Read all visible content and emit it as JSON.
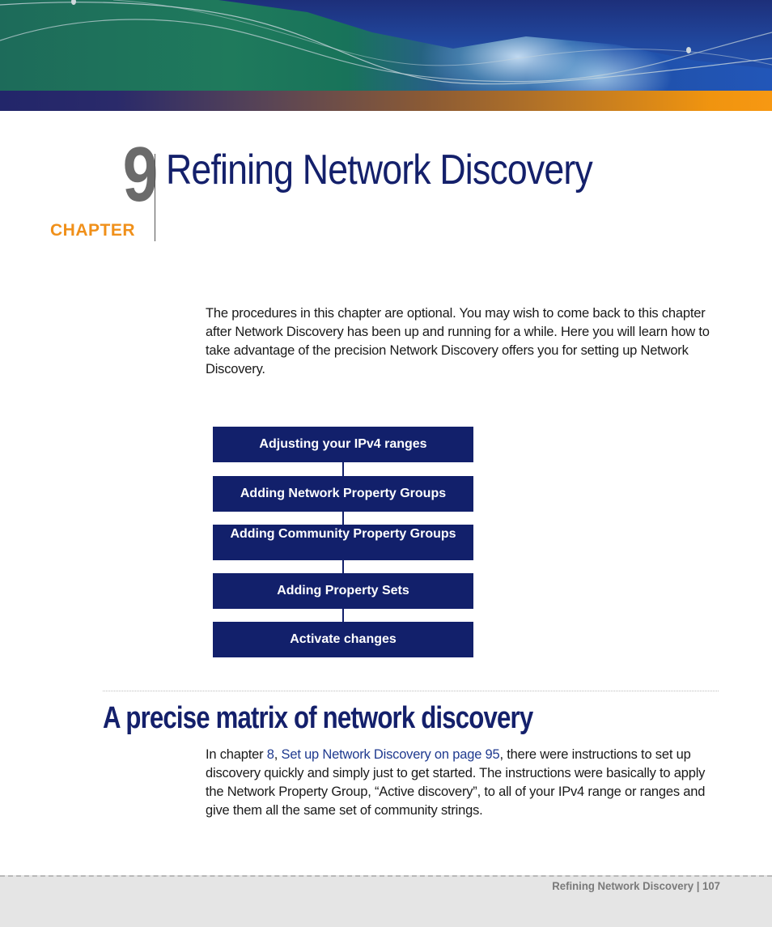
{
  "chapter": {
    "number": "9",
    "label": "CHAPTER",
    "title": "Refining Network Discovery"
  },
  "intro": {
    "text": "The procedures in this chapter are optional. You may wish to come back to this chapter after Network Discovery has been up and running for a while. Here you will learn how to take advantage of the precision Network Discovery offers you for setting up Network Discovery."
  },
  "flow": {
    "steps": [
      {
        "label": "Adjusting your IPv4 ranges"
      },
      {
        "label": "Adding Network Property Groups"
      },
      {
        "label": "Adding Community Property Groups"
      },
      {
        "label": "Adding Property Sets"
      },
      {
        "label": "Activate changes"
      }
    ]
  },
  "section": {
    "title": "A precise matrix of network discovery",
    "para_prefix": "In chapter ",
    "link_chapter": "8",
    "para_sep": ", ",
    "link_title": "Set up Network Discovery on page 95",
    "para_rest": ", there were instructions to set up discovery quickly and simply just to get started. The instructions were basically to apply the Network Property Group, “Active discovery”, to all of your IPv4 range or ranges and give them all the same set of community strings."
  },
  "footer": {
    "running_title": "Refining Network Discovery",
    "separator": " | ",
    "page_number": "107"
  },
  "colors": {
    "title_navy": "#14206b",
    "chapter_orange": "#f0901a",
    "chapter_number_gray": "#6b6b6b",
    "flow_box": "#12206b",
    "link_blue": "#1f3a8f",
    "footer_bg": "#e5e5e5"
  }
}
